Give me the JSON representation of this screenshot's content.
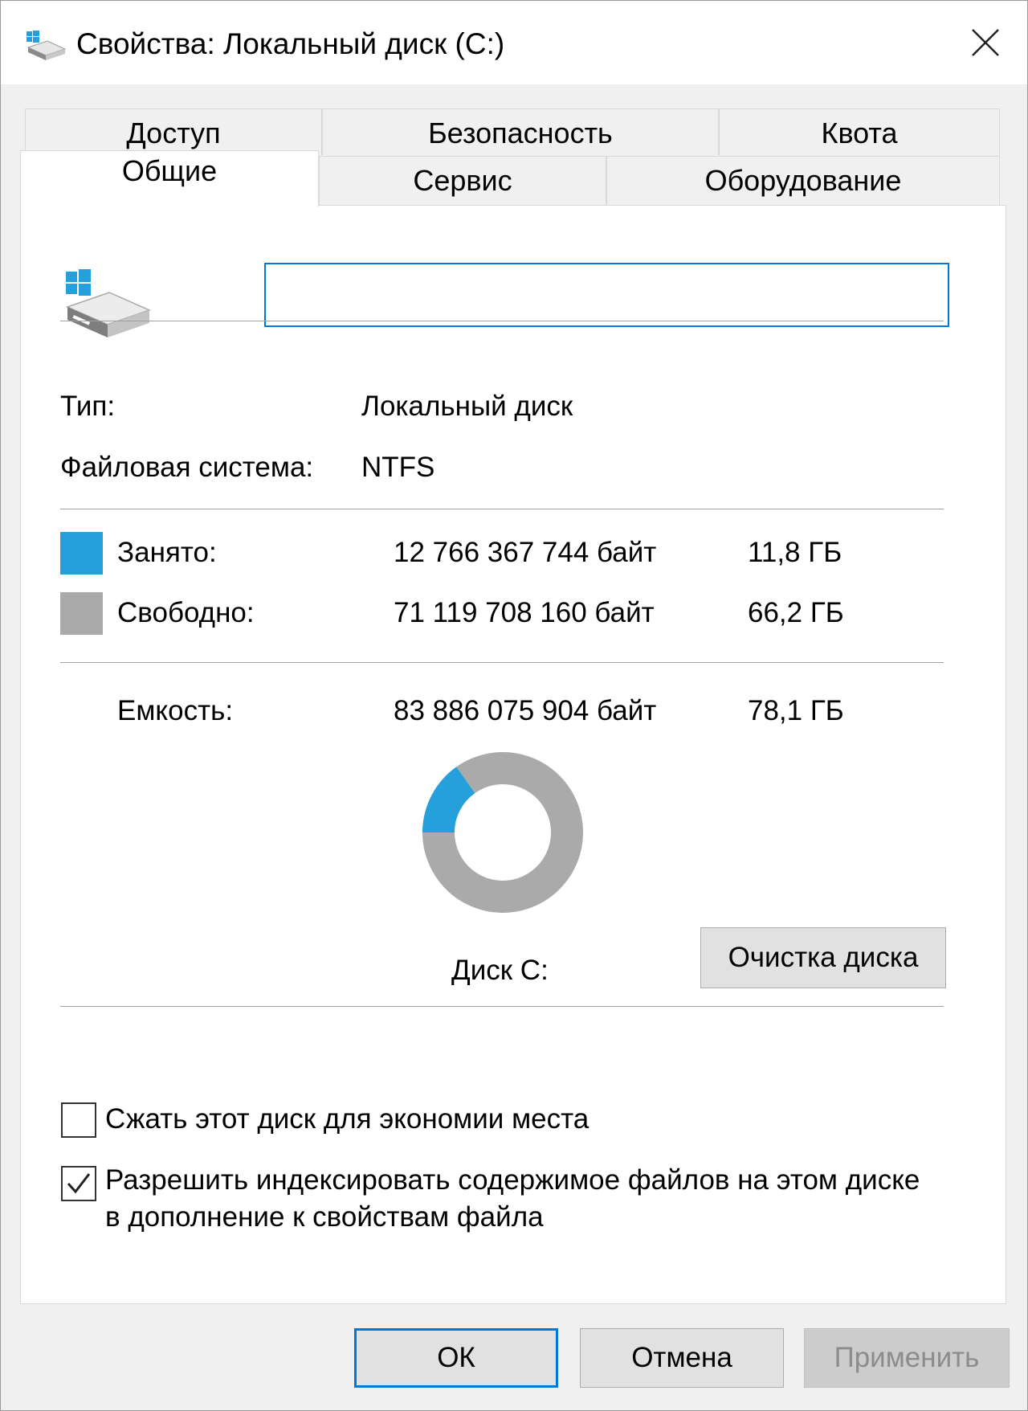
{
  "window": {
    "title": "Свойства: Локальный диск (C:)",
    "icon": "drive-icon",
    "close_icon": "close-icon"
  },
  "tabs": {
    "back_row": [
      {
        "label": "Доступ"
      },
      {
        "label": "Безопасность"
      },
      {
        "label": "Квота"
      }
    ],
    "front_row": [
      {
        "label": "Общие",
        "active": true
      },
      {
        "label": "Сервис"
      },
      {
        "label": "Оборудование"
      }
    ]
  },
  "general": {
    "name_value": "",
    "type_label": "Тип:",
    "type_value": "Локальный диск",
    "fs_label": "Файловая система:",
    "fs_value": "NTFS",
    "used": {
      "label": "Занято:",
      "bytes": "12 766 367 744 байт",
      "size": "11,8 ГБ",
      "color": "#26a0da"
    },
    "free": {
      "label": "Свободно:",
      "bytes": "71 119 708 160 байт",
      "size": "66,2 ГБ",
      "color": "#aaaaaa"
    },
    "capacity": {
      "label": "Емкость:",
      "bytes": "83 886 075 904 байт",
      "size": "78,1 ГБ"
    },
    "drive_label": "Диск C:",
    "cleanup_button": "Очистка диска",
    "compress_label": "Сжать этот диск для экономии места",
    "compress_checked": false,
    "index_label": "Разрешить индексировать содержимое файлов на этом диске в дополнение к свойствам файла",
    "index_checked": true
  },
  "chart_data": {
    "type": "pie",
    "categories": [
      "Занято",
      "Свободно"
    ],
    "values": [
      12766367744,
      71119708160
    ],
    "colors": [
      "#26a0da",
      "#aaaaaa"
    ]
  },
  "buttons": {
    "ok": "ОК",
    "cancel": "Отмена",
    "apply": "Применить"
  }
}
